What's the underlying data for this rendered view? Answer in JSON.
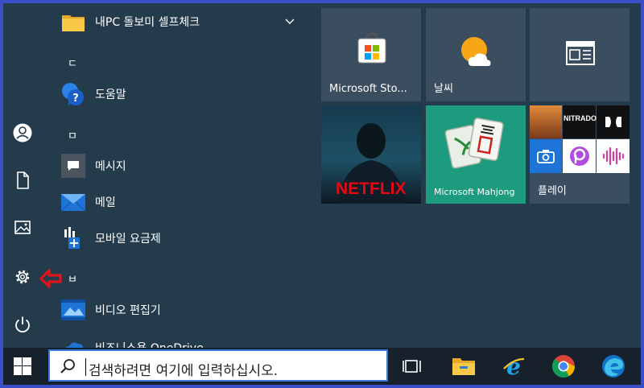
{
  "app_list": {
    "items": [
      {
        "label": "내PC 돌보미 셀프체크"
      },
      {
        "letter": "ㄷ"
      },
      {
        "label": "도움말"
      },
      {
        "letter": "ㅁ"
      },
      {
        "label": "메시지"
      },
      {
        "label": "메일"
      },
      {
        "label": "모바일 요금제"
      },
      {
        "letter": "ㅂ"
      },
      {
        "label": "비디오 편집기"
      },
      {
        "label": "비즈니스용 OneDrive"
      }
    ]
  },
  "tiles": {
    "store": "Microsoft Sto...",
    "weather": "날씨",
    "news": "",
    "netflix": "NETFLIX",
    "mahjong": "Microsoft Mahjong",
    "play": "플레이",
    "nitrado": "NITRADO"
  },
  "taskbar": {
    "search_text": "검색하려면 여기에 입력하십시오."
  },
  "icons": [
    "user-icon",
    "document-icon",
    "pictures-icon",
    "settings-icon",
    "power-icon",
    "windows-start-icon",
    "search-icon",
    "task-view-icon",
    "file-explorer-icon",
    "internet-explorer-icon",
    "chrome-icon",
    "edge-icon"
  ],
  "colors": {
    "background": "#243b4c",
    "taskbar": "#16212b",
    "accent": "#3b7ad9",
    "highlight_arrow": "#e0151b"
  }
}
